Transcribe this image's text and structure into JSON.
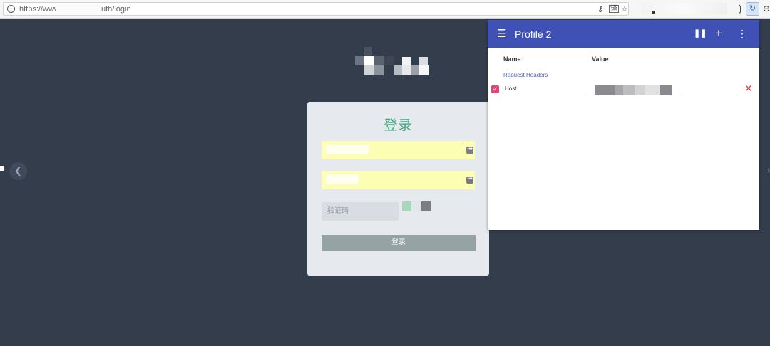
{
  "browser": {
    "url_prefix": "https://www.",
    "url_suffix": "uth/login",
    "info_icon": "info-icon",
    "omnibox_icons": [
      "key-icon",
      "translate-icon",
      "star-icon"
    ],
    "extension_icons": [
      "extension-icon",
      "modheader-icon",
      "pocket-icon"
    ]
  },
  "page": {
    "background": "#343d4c",
    "prev_icon": "chevron-left-icon"
  },
  "login": {
    "title": "登录",
    "captcha_placeholder": "验证码",
    "submit_label": "登录",
    "title_color": "#3fa77d",
    "autofill_color": "#fcffb3",
    "button_color": "#95a3a5"
  },
  "modheader": {
    "profile_title": "Profile 2",
    "header_color": "#3f51b5",
    "column_name": "Name",
    "column_value": "Value",
    "section_label": "Request Headers",
    "rows": [
      {
        "enabled": true,
        "name": "Host"
      }
    ]
  }
}
